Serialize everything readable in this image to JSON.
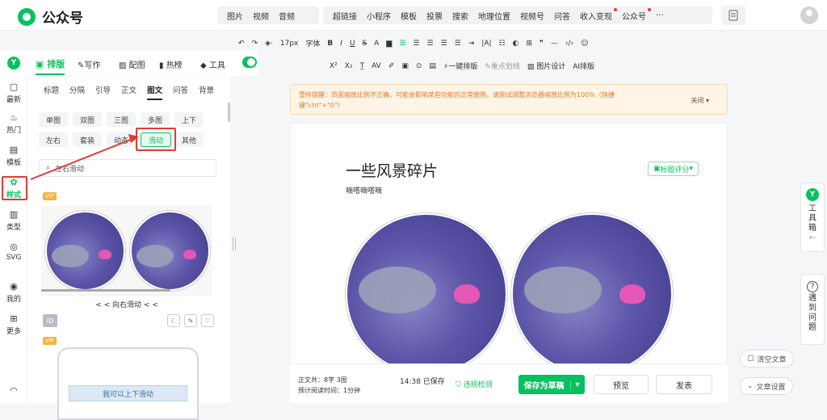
{
  "app": {
    "brand": "公众号"
  },
  "topnav": {
    "group1": [
      "图片",
      "视频",
      "音频"
    ],
    "group2": [
      "超链接",
      "小程序",
      "模板",
      "投票",
      "搜索",
      "地理位置",
      "视频号",
      "问答",
      "收入变现",
      "公众号"
    ],
    "more": "···"
  },
  "modetabs": [
    "排版",
    "写作",
    "配图",
    "热榜",
    "工具"
  ],
  "leftnav": [
    {
      "label": "最新"
    },
    {
      "label": "热门"
    },
    {
      "label": "模板"
    },
    {
      "label": "样式"
    },
    {
      "label": "类型"
    },
    {
      "label": "SVG"
    },
    {
      "label": "我的"
    },
    {
      "label": "更多"
    }
  ],
  "subtabs": [
    "标题",
    "分隔",
    "引导",
    "正文",
    "图文",
    "问答",
    "背景"
  ],
  "chips": [
    "单图",
    "双图",
    "三图",
    "多图",
    "上下",
    "左右",
    "套装",
    "动态",
    "滑动",
    "其他"
  ],
  "search": {
    "value": "左右滑动"
  },
  "templates": {
    "vip": "VIP",
    "caption1": "< < 向右滑动 < <",
    "id_label": "ID",
    "phone_text": "我可以上下滑动"
  },
  "toolbar": {
    "row1": [
      "17px",
      "字体",
      "B",
      "I",
      "U",
      "S",
      "A"
    ],
    "row2": [
      "X²",
      "X₂",
      "AV",
      "一键排版",
      "重点划线",
      "图片设计",
      "AI排版"
    ]
  },
  "notice": {
    "text": "壹伴提醒：页面缩放比例不正确，可能会影响某些功能的正常使用。请尝试调整浏览器缩放比例为100%（快捷键\"ctrl\"+\"0\"）",
    "close": "关闭"
  },
  "article": {
    "title": "一些风景碎片",
    "author": "嘀嗒嘀嗒嘀",
    "score_btn": "标题评分"
  },
  "bottom": {
    "wordcount_label": "正文共：",
    "wordcount": "8字 3图",
    "readtime_label": "预计阅读时间：",
    "readtime": "1分钟",
    "saved": "14:38 已保存",
    "check": "违规检测",
    "save_draft": "保存为草稿",
    "preview": "预览",
    "publish": "发表"
  },
  "rightside": {
    "toolbox": "工具箱",
    "help": "遇到问题",
    "clear": "清空文章",
    "settings": "文章设置"
  }
}
